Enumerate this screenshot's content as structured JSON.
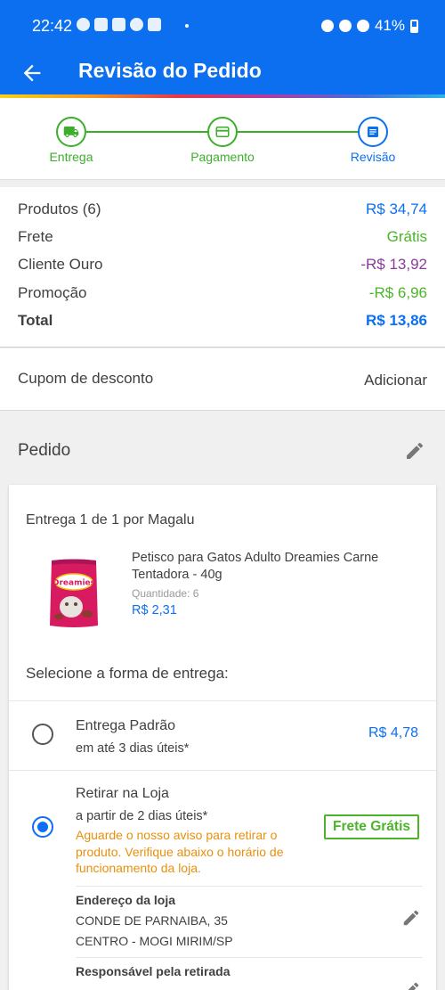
{
  "status_bar": {
    "time": "22:42",
    "battery": "41%"
  },
  "header": {
    "title": "Revisão do Pedido"
  },
  "steps": [
    {
      "label": "Entrega",
      "state": "done",
      "icon": "truck-icon"
    },
    {
      "label": "Pagamento",
      "state": "done",
      "icon": "credit-card-icon"
    },
    {
      "label": "Revisão",
      "state": "current",
      "icon": "document-icon"
    }
  ],
  "summary": {
    "products": {
      "label": "Produtos (6)",
      "value": "R$ 34,74"
    },
    "shipping": {
      "label": "Frete",
      "value": "Grátis"
    },
    "gold": {
      "label": "Cliente Ouro",
      "value": "-R$ 13,92"
    },
    "promo": {
      "label": "Promoção",
      "value": "-R$ 6,96"
    },
    "total": {
      "label": "Total",
      "value": "R$ 13,86"
    }
  },
  "coupon": {
    "label": "Cupom de desconto",
    "action": "Adicionar"
  },
  "order": {
    "title": "Pedido",
    "delivery_title": "Entrega 1 de 1 por Magalu",
    "product": {
      "name": "Petisco para Gatos Adulto Dreamies Carne Tentadora - 40g",
      "quantity": "Quantidade:  6",
      "price": "R$ 2,31",
      "brand": "Dreamies"
    },
    "select_title": "Selecione a forma de entrega:",
    "options": [
      {
        "title": "Entrega Padrão",
        "subtitle": "em até 3 dias úteis*",
        "price": "R$ 4,78",
        "selected": false
      },
      {
        "title": "Retirar na Loja",
        "subtitle": "a partir de 2 dias úteis*",
        "note": "Aguarde o nosso aviso para retirar o produto. Verifique abaixo o horário de funcionamento da loja.",
        "badge": "Frete Grátis",
        "selected": true
      }
    ],
    "store": {
      "address_label": "Endereço da loja",
      "address_line1": "CONDE DE PARNAIBA, 35",
      "address_line2": "CENTRO - MOGI MIRIM/SP",
      "responsible_label": "Responsável pela retirada"
    }
  },
  "colors": {
    "primary": "#0c6ff0",
    "green": "#4ab527",
    "purple": "#8a3a9c",
    "orange": "#e8900c"
  }
}
